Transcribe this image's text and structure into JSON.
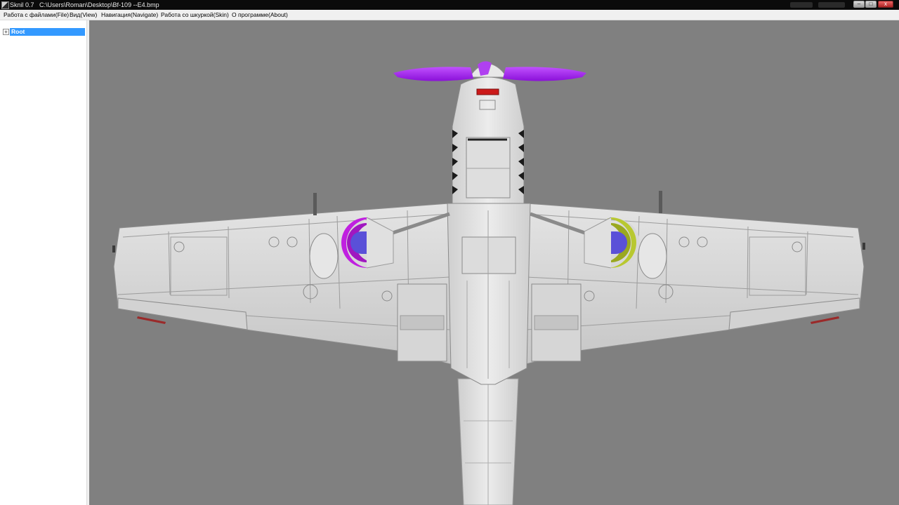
{
  "window": {
    "title": "Sknil 0.7   C:\\Users\\Roman\\Desktop\\Bf-109 --E4.bmp",
    "controls": {
      "minimize": "‒",
      "maximize": "□",
      "close": "x"
    }
  },
  "menu": {
    "file": "Работа с файлами(File)",
    "view": "Вид(View)",
    "navigate": "Навигация(Navigate)",
    "skin": "Работа со шкуркой(Skin)",
    "about": "О программе(About)"
  },
  "tree": {
    "expander": "+",
    "root_label": "Root"
  },
  "viewport": {
    "background": "#808080",
    "model": "Bf-109 E4 underside view",
    "colors": {
      "propeller": "#a020f0",
      "left_wheel_well": "#c020e0",
      "right_wheel_well": "#b8c830",
      "wheel_well_center": "#5a50d8",
      "aircraft_skin": "#d8d8d8",
      "wingtip_marker": "#9a2a2a",
      "radiator_marker": "#cc1a1a"
    }
  }
}
